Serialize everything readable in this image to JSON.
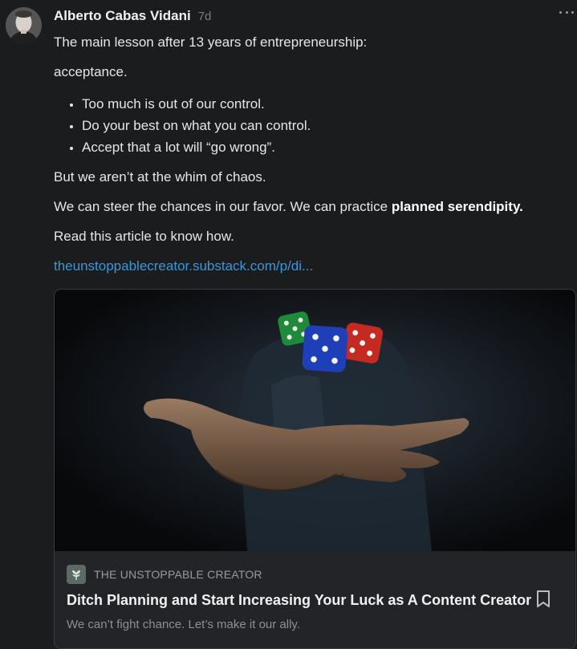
{
  "post": {
    "author": "Alberto Cabas Vidani",
    "time": "7d",
    "line1": "The main lesson after 13 years of entrepreneurship:",
    "line2": "acceptance.",
    "bullets": [
      "Too much is out of our control.",
      "Do your best on what you can control.",
      "Accept that a lot will “go wrong”."
    ],
    "line3": "But we aren’t at the whim of chaos.",
    "line4_prefix": "We can steer the chances in our favor. We can practice ",
    "line4_bold": "planned serendipity.",
    "line5": "Read this article to know how.",
    "link_text": "theunstoppablecreator.substack.com/p/di..."
  },
  "card": {
    "publication": "THE UNSTOPPABLE CREATOR",
    "title": "Ditch Planning and Start Increasing Your Luck as A Content Creator",
    "subtitle": "We can’t fight chance. Let’s make it our ally."
  },
  "icons": {
    "more": "more-horizontal-icon",
    "bookmark": "bookmark-icon",
    "publication_logo": "plant-logo-icon"
  },
  "colors": {
    "background": "#1b1c1e",
    "link": "#3a97d9",
    "card_bg": "#232427",
    "muted": "#7d7d7d"
  }
}
